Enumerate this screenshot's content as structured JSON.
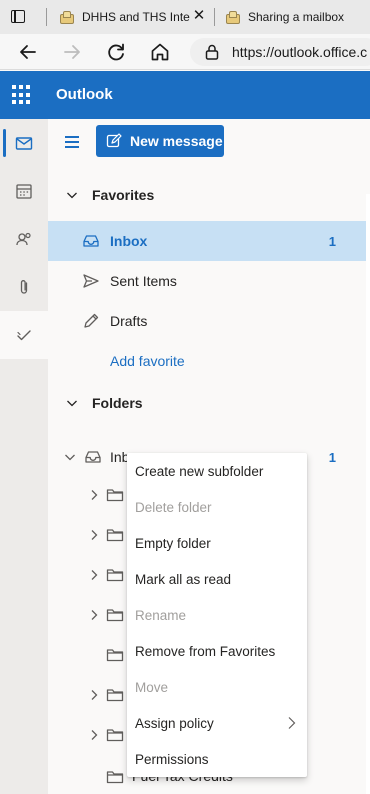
{
  "browser": {
    "tabs": [
      {
        "title": "DHHS and THS Inte",
        "close_symbol": "✕"
      },
      {
        "title": "Sharing a mailbox",
        "close_symbol": "✕"
      }
    ],
    "url": "https://outlook.office.c"
  },
  "app": {
    "title": "Outlook",
    "brand_color": "#1b6ec2"
  },
  "rail": [
    {
      "name": "mail-icon",
      "active": true
    },
    {
      "name": "calendar-icon",
      "active": false
    },
    {
      "name": "people-icon",
      "active": false
    },
    {
      "name": "attachment-icon",
      "active": false
    },
    {
      "name": "todo-icon",
      "active": false
    }
  ],
  "toolbar": {
    "new_message": "New message"
  },
  "favorites": {
    "header": "Favorites",
    "items": [
      {
        "label": "Inbox",
        "count": "1",
        "icon": "inbox-icon",
        "selected": true
      },
      {
        "label": "Sent Items",
        "count": "",
        "icon": "send-icon",
        "selected": false
      },
      {
        "label": "Drafts",
        "count": "",
        "icon": "pencil-icon",
        "selected": false
      }
    ],
    "add_favorite": "Add favorite"
  },
  "folders": {
    "header": "Folders",
    "inbox": {
      "label": "Inb",
      "count": "1"
    },
    "subfolders": [
      "",
      "",
      "",
      "",
      "",
      "",
      "",
      "",
      "Fuel Tax Credits"
    ]
  },
  "context_menu": {
    "items": [
      {
        "label": "Create new subfolder",
        "disabled": false,
        "submenu": false
      },
      {
        "label": "Delete folder",
        "disabled": true,
        "submenu": false
      },
      {
        "label": "Empty folder",
        "disabled": false,
        "submenu": false
      },
      {
        "label": "Mark all as read",
        "disabled": false,
        "submenu": false
      },
      {
        "label": "Rename",
        "disabled": true,
        "submenu": false
      },
      {
        "label": "Remove from Favorites",
        "disabled": false,
        "submenu": false
      },
      {
        "label": "Move",
        "disabled": true,
        "submenu": false
      },
      {
        "label": "Assign policy",
        "disabled": false,
        "submenu": true
      },
      {
        "label": "Permissions",
        "disabled": false,
        "submenu": false
      }
    ]
  }
}
